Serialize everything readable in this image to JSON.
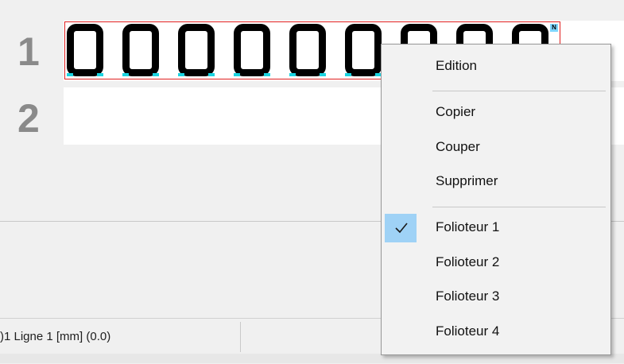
{
  "editor": {
    "line1_number": "1",
    "line2_number": "2",
    "digits": [
      "0",
      "0",
      "0",
      "0",
      "0",
      "0",
      "0",
      "0",
      "0"
    ],
    "badge": "N",
    "colors": {
      "selection_border": "#e02020",
      "digit_marker": "#19d3e0",
      "badge_bg": "#7ed6ff"
    }
  },
  "context_menu": {
    "items": [
      {
        "label": "Edition"
      },
      {
        "label": "Copier"
      },
      {
        "label": "Couper"
      },
      {
        "label": "Supprimer"
      },
      {
        "label": "Folioteur 1",
        "checked": true
      },
      {
        "label": "Folioteur 2"
      },
      {
        "label": "Folioteur 3"
      },
      {
        "label": "Folioteur 4"
      }
    ],
    "check_icon": "checkmark-icon",
    "highlight_color": "#9fd2f6"
  },
  "status_bar": {
    "left_text": ")1 Ligne 1 [mm] (0.0)"
  }
}
